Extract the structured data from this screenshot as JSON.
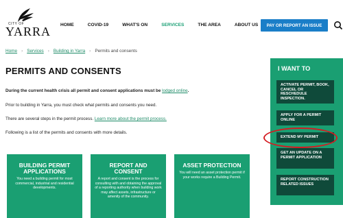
{
  "logo": {
    "small_text": "CITY OF",
    "name": "YARRA"
  },
  "nav": [
    {
      "label": "HOME",
      "active": false
    },
    {
      "label": "COVID-19",
      "active": false
    },
    {
      "label": "WHAT'S ON",
      "active": false
    },
    {
      "label": "SERVICES",
      "active": true
    },
    {
      "label": "THE AREA",
      "active": false
    },
    {
      "label": "ABOUT US",
      "active": false
    }
  ],
  "pay_button": "PAY OR REPORT AN ISSUE",
  "breadcrumb": {
    "home": "Home",
    "services": "Services",
    "building": "Building in Yarra",
    "current": "Permits and consents"
  },
  "page_title": "PERMITS AND CONSENTS",
  "paragraphs": {
    "p1_bold": "During the current health crisis all permit and consent applications must be ",
    "p1_link": "lodged online",
    "p1_end": ".",
    "p2": "Prior to building in Yarra, you must check what permits and consents you need.",
    "p3_text": "There are several steps in the permit process. ",
    "p3_link": "Learn more about the permit process.",
    "p4": "Following is a list of the permits and consents with more details."
  },
  "cards": [
    {
      "title": "BUILDING PERMIT APPLICATIONS",
      "desc": "You need a building permit for most commercial, industrial and residential developments."
    },
    {
      "title": "REPORT AND CONSENT",
      "desc": "A report and consent is the process for consulting with and obtaining the approval of a reporting authority when building work may affect assets, infrastructure or amenity of the community."
    },
    {
      "title": "ASSET PROTECTION",
      "desc": "You will need an asset protection permit if your works require a Building Permit."
    }
  ],
  "iwant": {
    "title": "I WANT TO",
    "items": [
      "ACTIVATE PERMIT, BOOK, CANCEL OR RESCHEDULE INSPECTION.",
      "APPLY FOR A PERMIT ONLINE",
      "EXTEND MY PERMIT",
      "GET AN UPDATE ON A PERMIT APPLICATION",
      "REPORT CONSTRUCTION RELATED ISSUES"
    ]
  },
  "colors": {
    "green": "#1a9f72",
    "dark_green": "#0f4a3a",
    "blue": "#1a7ec8",
    "highlight": "#d41c22"
  }
}
